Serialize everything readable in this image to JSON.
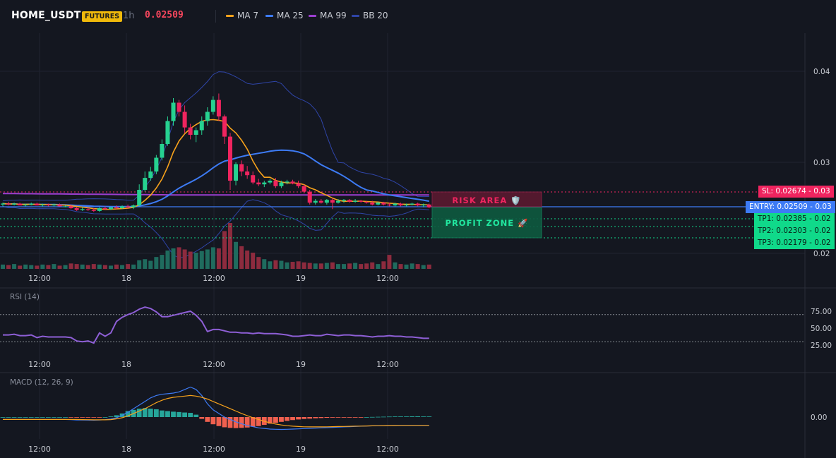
{
  "header": {
    "symbol": "HOME_USDT",
    "badge": "FUTURES",
    "timeframe": "1h",
    "price": "0.02509"
  },
  "legend": [
    {
      "label": "MA 7",
      "color": "#f7a21b"
    },
    {
      "label": "MA 25",
      "color": "#3d7bf5"
    },
    {
      "label": "MA 99",
      "color": "#9c3fd1"
    },
    {
      "label": "BB 20",
      "color": "#2f45a8"
    }
  ],
  "colors": {
    "up": "#26d190",
    "down": "#f0245f",
    "vol_up": "#1f6b5e",
    "vol_down": "#8d2b3e",
    "entry": "#3d7bf5",
    "sl": "#f0245f",
    "tp": "#10d98a",
    "rsi": "#8e5fd6",
    "macd": "#3d7bf5",
    "signal": "#f7a21b",
    "hist_pos": "#26a69a",
    "hist_neg": "#f0604f"
  },
  "panes": {
    "rsi_label": "RSI (14)",
    "macd_label": "MACD (12, 26, 9)"
  },
  "zones": {
    "risk_label": "RISK AREA 🛡️",
    "profit_label": "PROFIT ZONE 🚀"
  },
  "levels": {
    "sl": {
      "label": "SL: 0.02674",
      "axis": "0.03"
    },
    "entry": {
      "label": "ENTRY: 0.02509",
      "axis": "0.03"
    },
    "tp1": {
      "label": "TP1: 0.02385",
      "axis": "0.02"
    },
    "tp2": {
      "label": "TP2: 0.02303",
      "axis": "0.02"
    },
    "tp3": {
      "label": "TP3: 0.02179",
      "axis": "0.02"
    }
  },
  "chart_data": [
    {
      "type": "candlestick",
      "x_ticks": [
        "12:00",
        "18",
        "12:00",
        "19",
        "12:00"
      ],
      "y_ticks": [
        "0.04",
        "0.03",
        "0.02"
      ],
      "ohlc": [
        [
          0.0254,
          0.0256,
          0.0252,
          0.0255
        ],
        [
          0.0255,
          0.0257,
          0.0253,
          0.0254
        ],
        [
          0.0254,
          0.0256,
          0.0253,
          0.0255
        ],
        [
          0.0255,
          0.0256,
          0.0253,
          0.0253
        ],
        [
          0.0253,
          0.0255,
          0.0252,
          0.0254
        ],
        [
          0.0254,
          0.0256,
          0.0253,
          0.0255
        ],
        [
          0.0255,
          0.0256,
          0.0253,
          0.0253
        ],
        [
          0.0253,
          0.0255,
          0.0252,
          0.0254
        ],
        [
          0.0254,
          0.0255,
          0.0252,
          0.0253
        ],
        [
          0.0253,
          0.0255,
          0.0252,
          0.0254
        ],
        [
          0.0254,
          0.0255,
          0.0252,
          0.0252
        ],
        [
          0.0252,
          0.0253,
          0.0251,
          0.0252
        ],
        [
          0.0252,
          0.0254,
          0.0249,
          0.025
        ],
        [
          0.025,
          0.0251,
          0.0247,
          0.0248
        ],
        [
          0.0248,
          0.0251,
          0.0247,
          0.0249
        ],
        [
          0.0249,
          0.0251,
          0.0247,
          0.0248
        ],
        [
          0.0248,
          0.025,
          0.0246,
          0.0247
        ],
        [
          0.0247,
          0.0251,
          0.0246,
          0.025
        ],
        [
          0.025,
          0.0252,
          0.0248,
          0.0249
        ],
        [
          0.0249,
          0.0251,
          0.0248,
          0.0251
        ],
        [
          0.0251,
          0.0253,
          0.0249,
          0.025
        ],
        [
          0.025,
          0.0253,
          0.0249,
          0.0252
        ],
        [
          0.0252,
          0.0254,
          0.025,
          0.0251
        ],
        [
          0.0251,
          0.0254,
          0.0249,
          0.0253
        ],
        [
          0.0253,
          0.0276,
          0.0252,
          0.027
        ],
        [
          0.027,
          0.029,
          0.0268,
          0.0283
        ],
        [
          0.0283,
          0.0295,
          0.028,
          0.029
        ],
        [
          0.029,
          0.0308,
          0.0287,
          0.0305
        ],
        [
          0.0305,
          0.0325,
          0.0302,
          0.032
        ],
        [
          0.032,
          0.035,
          0.0318,
          0.0345
        ],
        [
          0.0345,
          0.037,
          0.034,
          0.0365
        ],
        [
          0.0365,
          0.0368,
          0.035,
          0.0355
        ],
        [
          0.0355,
          0.0362,
          0.0332,
          0.0338
        ],
        [
          0.0338,
          0.0342,
          0.0325,
          0.033
        ],
        [
          0.033,
          0.0338,
          0.0322,
          0.0335
        ],
        [
          0.0335,
          0.035,
          0.033,
          0.0345
        ],
        [
          0.0345,
          0.036,
          0.034,
          0.0355
        ],
        [
          0.0355,
          0.0372,
          0.0352,
          0.0368
        ],
        [
          0.0368,
          0.0375,
          0.0345,
          0.035
        ],
        [
          0.035,
          0.0352,
          0.032,
          0.0328
        ],
        [
          0.0328,
          0.0332,
          0.027,
          0.028
        ],
        [
          0.028,
          0.03,
          0.0275,
          0.0298
        ],
        [
          0.0298,
          0.0302,
          0.0285,
          0.029
        ],
        [
          0.029,
          0.0296,
          0.0282,
          0.0286
        ],
        [
          0.0286,
          0.029,
          0.0276,
          0.0278
        ],
        [
          0.0278,
          0.0282,
          0.0274,
          0.0276
        ],
        [
          0.0276,
          0.028,
          0.0273,
          0.0278
        ],
        [
          0.0278,
          0.0282,
          0.0276,
          0.028
        ],
        [
          0.028,
          0.0283,
          0.0272,
          0.0274
        ],
        [
          0.0274,
          0.028,
          0.0272,
          0.0278
        ],
        [
          0.0278,
          0.0281,
          0.0276,
          0.0279
        ],
        [
          0.0279,
          0.0281,
          0.0276,
          0.0277
        ],
        [
          0.0277,
          0.028,
          0.0272,
          0.0274
        ],
        [
          0.0274,
          0.0276,
          0.0266,
          0.0268
        ],
        [
          0.0268,
          0.027,
          0.0254,
          0.0256
        ],
        [
          0.0256,
          0.026,
          0.0254,
          0.0258
        ],
        [
          0.0258,
          0.026,
          0.0255,
          0.0256
        ],
        [
          0.0256,
          0.026,
          0.0254,
          0.0259
        ],
        [
          0.0259,
          0.0261,
          0.0249,
          0.0256
        ],
        [
          0.0256,
          0.026,
          0.0255,
          0.0258
        ],
        [
          0.0258,
          0.026,
          0.0256,
          0.0259
        ],
        [
          0.0259,
          0.026,
          0.0256,
          0.0257
        ],
        [
          0.0257,
          0.026,
          0.0256,
          0.0258
        ],
        [
          0.0258,
          0.0259,
          0.0256,
          0.0257
        ],
        [
          0.0257,
          0.0258,
          0.0255,
          0.0256
        ],
        [
          0.0256,
          0.0258,
          0.0253,
          0.0254
        ],
        [
          0.0254,
          0.0257,
          0.0253,
          0.0256
        ],
        [
          0.0256,
          0.0257,
          0.0253,
          0.0254
        ],
        [
          0.0254,
          0.0256,
          0.0252,
          0.0253
        ],
        [
          0.0253,
          0.0256,
          0.0252,
          0.0255
        ],
        [
          0.0255,
          0.0256,
          0.0252,
          0.0253
        ],
        [
          0.0253,
          0.0255,
          0.0252,
          0.0254
        ],
        [
          0.0254,
          0.0256,
          0.0253,
          0.0255
        ],
        [
          0.0255,
          0.0256,
          0.0252,
          0.0253
        ],
        [
          0.0253,
          0.0255,
          0.0251,
          0.0254
        ],
        [
          0.0254,
          0.0255,
          0.025,
          0.0251
        ]
      ],
      "volume": [
        8,
        7,
        9,
        6,
        8,
        7,
        6,
        8,
        7,
        9,
        6,
        7,
        10,
        9,
        8,
        7,
        9,
        8,
        7,
        6,
        8,
        7,
        9,
        8,
        16,
        18,
        15,
        22,
        26,
        34,
        38,
        40,
        36,
        32,
        30,
        33,
        36,
        40,
        38,
        70,
        85,
        50,
        42,
        34,
        30,
        22,
        18,
        14,
        16,
        15,
        12,
        13,
        14,
        12,
        11,
        10,
        10,
        11,
        12,
        9,
        9,
        10,
        11,
        9,
        10,
        12,
        9,
        14,
        26,
        12,
        9,
        8,
        10,
        9,
        7,
        8
      ]
    },
    {
      "type": "line",
      "name": "RSI (14)",
      "y_ticks": [
        "75.00",
        "50.00",
        "25.00"
      ],
      "values": [
        40,
        40,
        41,
        39,
        39,
        40,
        36,
        38,
        37,
        37,
        37,
        37,
        36,
        31,
        30,
        31,
        28,
        43,
        38,
        43,
        60,
        66,
        70,
        73,
        78,
        81,
        79,
        74,
        67,
        67,
        69,
        71,
        73,
        75,
        69,
        60,
        45,
        48,
        48,
        46,
        44,
        44,
        43,
        43,
        42,
        43,
        42,
        42,
        42,
        41,
        40,
        38,
        38,
        39,
        40,
        39,
        39,
        41,
        40,
        39,
        40,
        40,
        39,
        39,
        38,
        37,
        38,
        38,
        39,
        38,
        38,
        37,
        37,
        36,
        35,
        35
      ]
    },
    {
      "type": "line",
      "name": "MACD (12, 26, 9)",
      "y_ticks": [
        "0.00"
      ],
      "macd": [
        -2,
        -2,
        -2,
        -2,
        -2,
        -2,
        -2,
        -2,
        -2,
        -2,
        -2,
        -2,
        -2.2,
        -2.4,
        -2.4,
        -2.5,
        -2.6,
        -2.4,
        -2.2,
        -1.6,
        -0.5,
        1.5,
        4,
        7,
        10,
        13,
        16,
        18,
        19,
        19.5,
        20,
        21,
        23,
        25,
        23,
        18,
        11,
        6,
        3,
        0,
        -2,
        -4,
        -5.5,
        -7,
        -8,
        -9,
        -9.5,
        -10,
        -10.2,
        -10.3,
        -10.2,
        -10,
        -9.8,
        -9.6,
        -9.4,
        -9.2,
        -9,
        -8.8,
        -8.6,
        -8.4,
        -8.2,
        -8,
        -7.8,
        -7.6,
        -7.4,
        -7.3,
        -7.2,
        -7.1,
        -7,
        -6.9,
        -6.9,
        -6.9,
        -6.9,
        -6.9,
        -6.9,
        -6.9
      ],
      "signal": [
        -2,
        -2,
        -2,
        -2,
        -2,
        -2,
        -2,
        -2,
        -2,
        -2,
        -2,
        -2,
        -2,
        -2,
        -2.1,
        -2.2,
        -2.3,
        -2.3,
        -2.3,
        -2.1,
        -1.5,
        -0.5,
        1,
        3,
        5,
        7,
        9.5,
        12,
        14,
        15.5,
        16.5,
        17,
        17.5,
        18,
        17.5,
        16.5,
        15,
        13,
        11,
        9,
        7,
        5,
        3,
        1.2,
        -0.5,
        -2,
        -3.5,
        -4.8,
        -5.8,
        -6.6,
        -7.2,
        -7.6,
        -7.9,
        -8.1,
        -8.2,
        -8.2,
        -8.2,
        -8.1,
        -8,
        -7.9,
        -7.8,
        -7.7,
        -7.6,
        -7.5,
        -7.4,
        -7.3,
        -7.2,
        -7.1,
        -7,
        -7,
        -6.9,
        -6.9,
        -6.9,
        -6.9,
        -6.9,
        -6.9
      ],
      "histogram": [
        0,
        0,
        0,
        0,
        0,
        0,
        0,
        0,
        0,
        0,
        0,
        0,
        -0.2,
        -0.4,
        -0.4,
        -0.4,
        -0.4,
        -0.2,
        0,
        0.5,
        1.5,
        3,
        5,
        6,
        7,
        7.5,
        7,
        6.5,
        5.5,
        5,
        4.5,
        4.2,
        3.8,
        3.5,
        2,
        -1.5,
        -4,
        -6,
        -7.5,
        -8.5,
        -9,
        -9.2,
        -9,
        -8.7,
        -8,
        -7.5,
        -6.5,
        -5.5,
        -4.8,
        -4,
        -3.2,
        -2.5,
        -2,
        -1.6,
        -1.3,
        -1,
        -0.8,
        -0.6,
        -0.5,
        -0.4,
        -0.3,
        -0.2,
        -0.2,
        -0.1,
        0,
        0.1,
        0.2,
        0.3,
        0.4,
        0.5,
        0.5,
        0.5,
        0.6,
        0.6,
        0.5,
        0.5
      ]
    }
  ]
}
